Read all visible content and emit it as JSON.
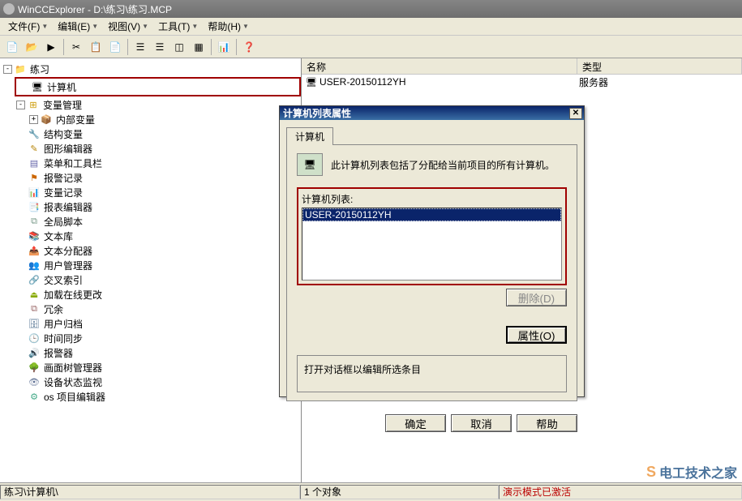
{
  "window": {
    "title": "WinCCExplorer - D:\\练习\\练习.MCP"
  },
  "menus": {
    "file": "文件(F)",
    "edit": "编辑(E)",
    "view": "视图(V)",
    "tools": "工具(T)",
    "help": "帮助(H)"
  },
  "tree": {
    "root": "练习",
    "computer": "计算机",
    "var_mgmt": "变量管理",
    "internal": "内部变量",
    "struct": "结构变量",
    "gfx": "图形编辑器",
    "menu_tb": "菜单和工具栏",
    "alarm_log": "报警记录",
    "var_log": "变量记录",
    "report": "报表编辑器",
    "global_script": "全局脚本",
    "text_lib": "文本库",
    "text_dist": "文本分配器",
    "user_mgr": "用户管理器",
    "xref": "交叉索引",
    "load_online": "加载在线更改",
    "redund": "冗余",
    "user_arch": "用户归档",
    "time_sync": "时间同步",
    "horn": "报警器",
    "screen_tree": "画面树管理器",
    "dev_status": "设备状态监视",
    "os_editor": "os 项目编辑器"
  },
  "list": {
    "col_name": "名称",
    "col_type": "类型",
    "row_name": "USER-20150112YH",
    "row_type": "服务器"
  },
  "dialog": {
    "title": "计算机列表属性",
    "tab": "计算机",
    "info": "此计算机列表包括了分配给当前项目的所有计算机。",
    "list_label": "计算机列表:",
    "item": "USER-20150112YH",
    "delete": "删除(D)",
    "props": "属性(O)",
    "hint": "打开对话框以编辑所选条目",
    "ok": "确定",
    "cancel": "取消",
    "help": "帮助"
  },
  "status": {
    "path": "练习\\计算机\\",
    "count": "1 个对象",
    "mode": "演示模式已激活"
  },
  "watermark": "电工技术之家"
}
